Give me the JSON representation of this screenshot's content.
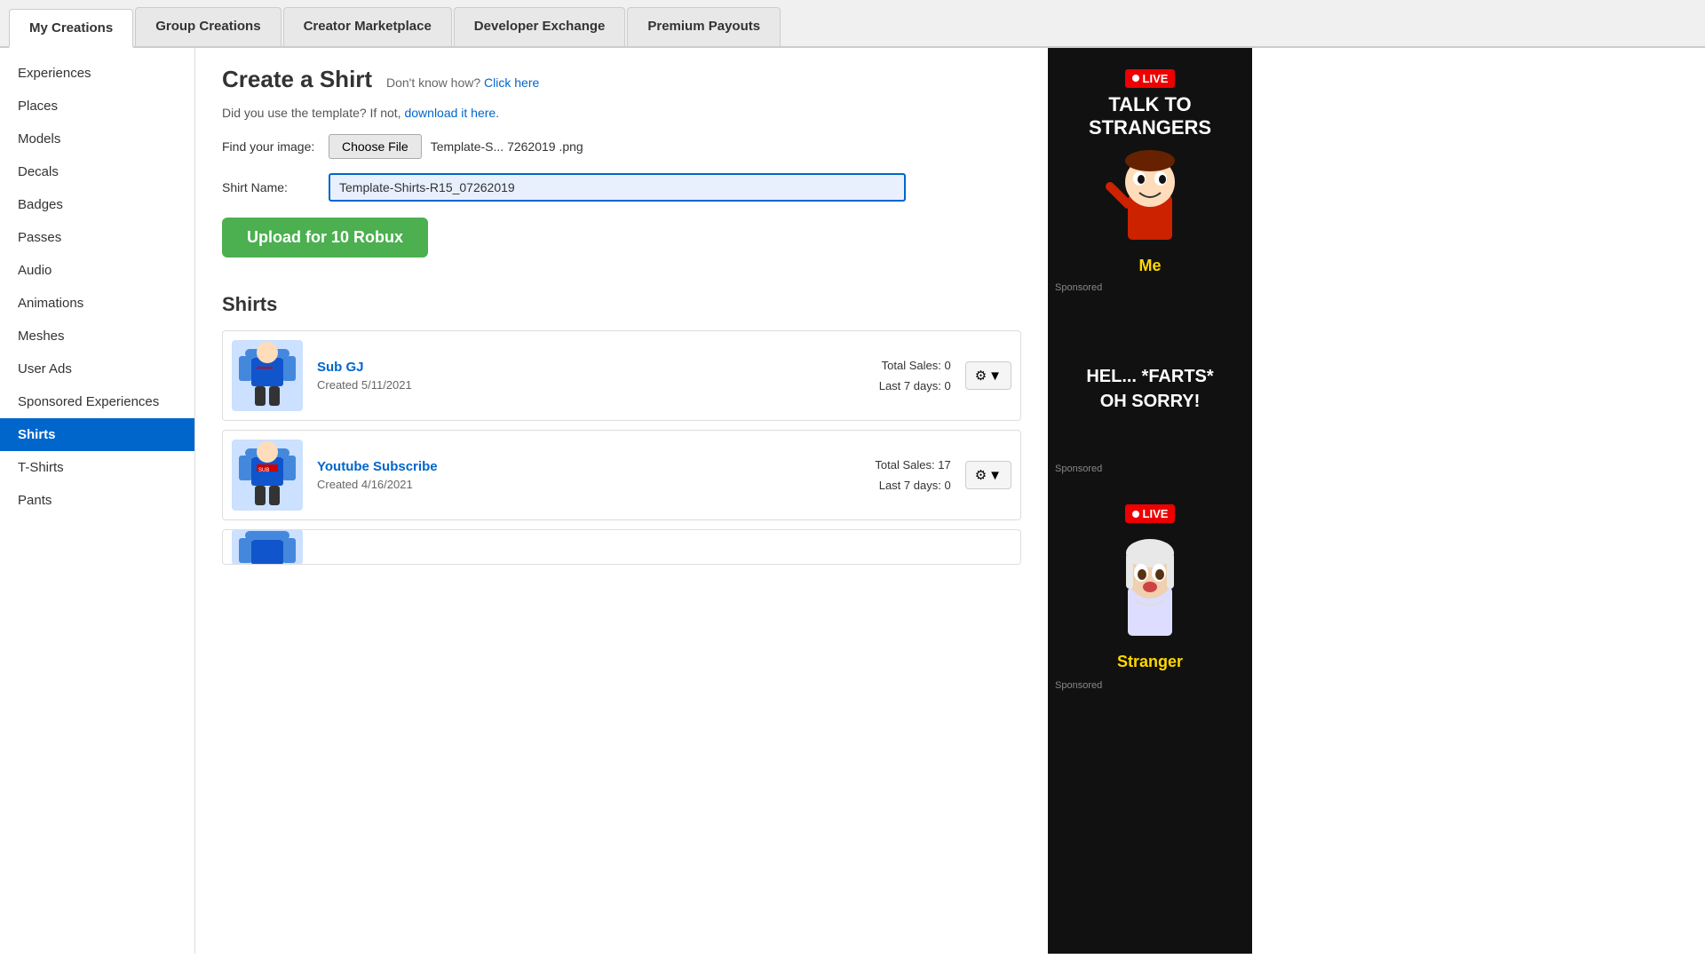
{
  "nav": {
    "tabs": [
      {
        "label": "My Creations",
        "active": true
      },
      {
        "label": "Group Creations",
        "active": false
      },
      {
        "label": "Creator Marketplace",
        "active": false
      },
      {
        "label": "Developer Exchange",
        "active": false
      },
      {
        "label": "Premium Payouts",
        "active": false
      }
    ]
  },
  "sidebar": {
    "items": [
      {
        "label": "Experiences",
        "active": false
      },
      {
        "label": "Places",
        "active": false
      },
      {
        "label": "Models",
        "active": false
      },
      {
        "label": "Decals",
        "active": false
      },
      {
        "label": "Badges",
        "active": false
      },
      {
        "label": "Passes",
        "active": false
      },
      {
        "label": "Audio",
        "active": false
      },
      {
        "label": "Animations",
        "active": false
      },
      {
        "label": "Meshes",
        "active": false
      },
      {
        "label": "User Ads",
        "active": false
      },
      {
        "label": "Sponsored Experiences",
        "active": false
      },
      {
        "label": "Shirts",
        "active": true
      },
      {
        "label": "T-Shirts",
        "active": false
      },
      {
        "label": "Pants",
        "active": false
      }
    ]
  },
  "create_shirt": {
    "title": "Create a Shirt",
    "subtitle_text": "Don't know how?",
    "subtitle_link": "Click here",
    "template_text": "Did you use the template? If not,",
    "template_link": "download it here.",
    "find_image_label": "Find your image:",
    "choose_file_btn": "Choose File",
    "file_name": "Template-S... 7262019 .png",
    "shirt_name_label": "Shirt Name:",
    "shirt_name_value": "Template-Shirts-R15_07262019",
    "upload_btn": "Upload for 10 Robux"
  },
  "shirts_section": {
    "title": "Shirts",
    "items": [
      {
        "name": "Sub GJ",
        "created": "Created  5/11/2021",
        "total_sales_label": "Total Sales:",
        "total_sales_value": "0",
        "last7_label": "Last 7 days:",
        "last7_value": "0"
      },
      {
        "name": "Youtube Subscribe",
        "created": "Created  4/16/2021",
        "total_sales_label": "Total Sales:",
        "total_sales_value": "17",
        "last7_label": "Last 7 days:",
        "last7_value": "0"
      }
    ]
  },
  "ads": [
    {
      "type": "talk_to_strangers",
      "title": "TALK TO\nSTRANGERS",
      "badge": "LIVE",
      "username": "Me"
    },
    {
      "type": "farts",
      "line1": "HEL... *FARTS*",
      "line2": "OH SORRY!"
    },
    {
      "type": "stranger2",
      "badge": "LIVE",
      "username": "Stranger"
    }
  ],
  "sponsored_label": "Sponsored"
}
